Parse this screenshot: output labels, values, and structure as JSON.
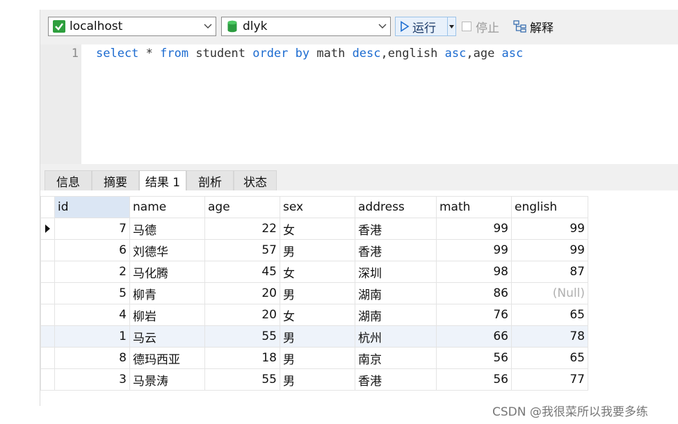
{
  "toolbar": {
    "connection": "localhost",
    "database": "dlyk",
    "run_label": "运行",
    "stop_label": "停止",
    "explain_label": "解释"
  },
  "editor": {
    "line_number": "1",
    "tokens": [
      {
        "t": "select",
        "k": true
      },
      {
        "t": " * ",
        "k": false
      },
      {
        "t": "from",
        "k": true
      },
      {
        "t": " student ",
        "k": false
      },
      {
        "t": "order",
        "k": true
      },
      {
        "t": " ",
        "k": false
      },
      {
        "t": "by",
        "k": true
      },
      {
        "t": " math ",
        "k": false
      },
      {
        "t": "desc",
        "k": true
      },
      {
        "t": ",english ",
        "k": false
      },
      {
        "t": "asc",
        "k": true
      },
      {
        "t": ",age ",
        "k": false
      },
      {
        "t": "asc",
        "k": true
      }
    ]
  },
  "tabs": [
    "信息",
    "摘要",
    "结果 1",
    "剖析",
    "状态"
  ],
  "active_tab": "结果 1",
  "results": {
    "columns": [
      "id",
      "name",
      "age",
      "sex",
      "address",
      "math",
      "english"
    ],
    "rows": [
      [
        "7",
        "马德",
        "22",
        "女",
        "香港",
        "99",
        "99"
      ],
      [
        "6",
        "刘德华",
        "57",
        "男",
        "香港",
        "99",
        "99"
      ],
      [
        "2",
        "马化腾",
        "45",
        "女",
        "深圳",
        "98",
        "87"
      ],
      [
        "5",
        "柳青",
        "20",
        "男",
        "湖南",
        "86",
        "(Null)"
      ],
      [
        "4",
        "柳岩",
        "20",
        "女",
        "湖南",
        "76",
        "65"
      ],
      [
        "1",
        "马云",
        "55",
        "男",
        "杭州",
        "66",
        "78"
      ],
      [
        "8",
        "德玛西亚",
        "18",
        "男",
        "南京",
        "56",
        "65"
      ],
      [
        "3",
        "马景涛",
        "55",
        "男",
        "香港",
        "56",
        "77"
      ]
    ]
  },
  "watermark": "CSDN @我很菜所以我要多练",
  "colors": {
    "keyword": "#1c6bd0",
    "null": "#b0b0b0",
    "selected_header": "#dbe6f4"
  }
}
